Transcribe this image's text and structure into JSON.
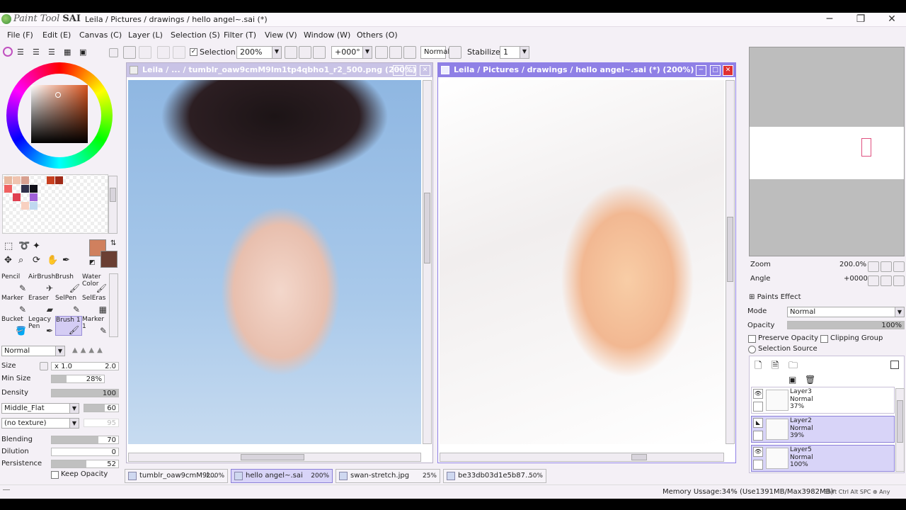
{
  "app": {
    "logo_text": "Paint Tool",
    "logo_bold": "SAI",
    "title": "Leila / Pictures / drawings / hello angel~.sai (*)"
  },
  "window_controls": [
    "─",
    "❐",
    "✕"
  ],
  "menu": [
    "File (F)",
    "Edit (E)",
    "Canvas (C)",
    "Layer (L)",
    "Selection (S)",
    "Filter (T)",
    "View (V)",
    "Window (W)",
    "Others (O)"
  ],
  "toolbar": {
    "selection_label": "Selection",
    "zoom": "200%",
    "angle": "+000°",
    "blend": "Normal",
    "stabilizer_label": "Stabilizer",
    "stabilizer_value": "1"
  },
  "tools": [
    {
      "label": "Pencil",
      "icon": "✎"
    },
    {
      "label": "AirBrush",
      "icon": "✈"
    },
    {
      "label": "Brush",
      "icon": "🖌"
    },
    {
      "label": "Water Color",
      "icon": "🖌"
    },
    {
      "label": "Marker",
      "icon": "✎"
    },
    {
      "label": "Eraser",
      "icon": "▰"
    },
    {
      "label": "SelPen",
      "icon": "✎"
    },
    {
      "label": "SelEras",
      "icon": "▦"
    },
    {
      "label": "Bucket",
      "icon": "🪣"
    },
    {
      "label": "Legacy Pen",
      "icon": "✒"
    },
    {
      "label": "Brush 1",
      "icon": "🖌"
    },
    {
      "label": "Marker 1",
      "icon": "✎"
    }
  ],
  "brush": {
    "mode": "Normal",
    "size_label": "Size",
    "size_mult": "x 1.0",
    "size_value": "2.0",
    "min_size_label": "Min Size",
    "min_size_value": "28%",
    "min_size_fill": 0.28,
    "density_label": "Density",
    "density_value": "100",
    "density_fill": 1.0,
    "shape": "Middle_Flat",
    "shape_value": "60",
    "shape_fill": 0.6,
    "texture": "(no texture)",
    "texture_value": "95",
    "blending_label": "Blending",
    "blending_value": "70",
    "blending_fill": 0.7,
    "dilution_label": "Dilution",
    "dilution_value": "0",
    "dilution_fill": 0.0,
    "persistence_label": "Persistence",
    "persistence_value": "52",
    "persistence_fill": 0.52,
    "keep_opacity_label": "Keep Opacity"
  },
  "canvases": [
    {
      "title": "Leila / ... / tumblr_oaw9cmM9lm1tp4qbho1_r2_500.png (200%)",
      "active": false
    },
    {
      "title": "Leila / Pictures / drawings / hello angel~.sai (*) (200%)",
      "active": true
    }
  ],
  "navigator": {
    "zoom_label": "Zoom",
    "zoom_value": "200.0%",
    "angle_label": "Angle",
    "angle_value": "+0000"
  },
  "layers_panel": {
    "paints_effect": "Paints Effect",
    "mode_label": "Mode",
    "mode_value": "Normal",
    "opacity_label": "Opacity",
    "opacity_value": "100%",
    "preserve_opacity": "Preserve Opacity",
    "clipping_group": "Clipping Group",
    "selection_source": "Selection Source",
    "layers": [
      {
        "name": "Layer3",
        "mode": "Normal",
        "opacity": "37%",
        "selected": false
      },
      {
        "name": "Layer2",
        "mode": "Normal",
        "opacity": "39%",
        "selected": true
      },
      {
        "name": "Layer5",
        "mode": "Normal",
        "opacity": "100%",
        "selected": true
      }
    ]
  },
  "tabs": [
    {
      "name": "tumblr_oaw9cmM9l...",
      "zoom": "200%",
      "active": false
    },
    {
      "name": "hello angel~.sai",
      "zoom": "200%",
      "active": true
    },
    {
      "name": "swan-stretch.jpg",
      "zoom": "25%",
      "active": false
    },
    {
      "name": "be33db03d1e5b87...",
      "zoom": "50%",
      "active": false
    }
  ],
  "status": {
    "memory": "Memory Ussage:34% (Use1391MB/Max3982MB)",
    "keys": "Shift Ctrl Alt SPC ⊕ Any"
  },
  "colors": {
    "accent": "#8a7ae0",
    "active_title": "#8f80e6",
    "inactive_title": "#c9c3e6",
    "fg_color": "#d0805e",
    "bg_color": "#6a3f33"
  },
  "palette": [
    "#e8b9a0",
    "#f0c4b0",
    "#d8a090",
    "#ffffff",
    "#c84020",
    "#a02a18",
    "#f06060",
    "#e04050",
    "#30304a",
    "#101018",
    "#ffffff",
    "#ffffff",
    "#f8d0c0",
    "#c0d8f0",
    "#ffffff",
    "#a060d8",
    "#ffffff",
    "#ffffff"
  ]
}
